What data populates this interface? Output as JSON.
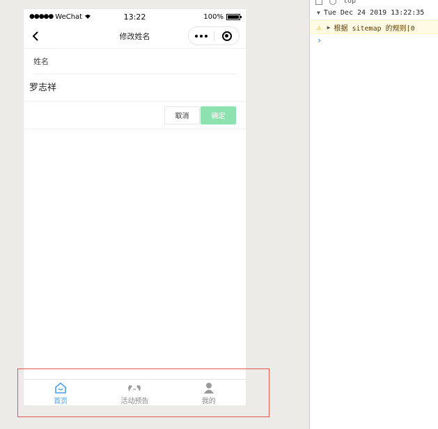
{
  "statusbar": {
    "carrier": "WeChat",
    "time": "13:22",
    "battery": "100%"
  },
  "navbar": {
    "title": "修改姓名"
  },
  "form": {
    "label": "姓名",
    "value": "罗志祥"
  },
  "actions": {
    "cancel": "取消",
    "confirm": "确定"
  },
  "tabbar": {
    "items": [
      {
        "label": "首页",
        "icon": "home-icon",
        "active": true
      },
      {
        "label": "活动预告",
        "icon": "flags-icon",
        "active": false
      },
      {
        "label": "我的",
        "icon": "user-icon",
        "active": false
      }
    ]
  },
  "console": {
    "context": "top",
    "group_header": "Tue Dec 24 2019 13:22:35",
    "warning": "根据 sitemap 的规则[0"
  },
  "colors": {
    "accent": "#4aa0f0",
    "confirm": "#8de2b0",
    "highlight": "#e05454"
  }
}
